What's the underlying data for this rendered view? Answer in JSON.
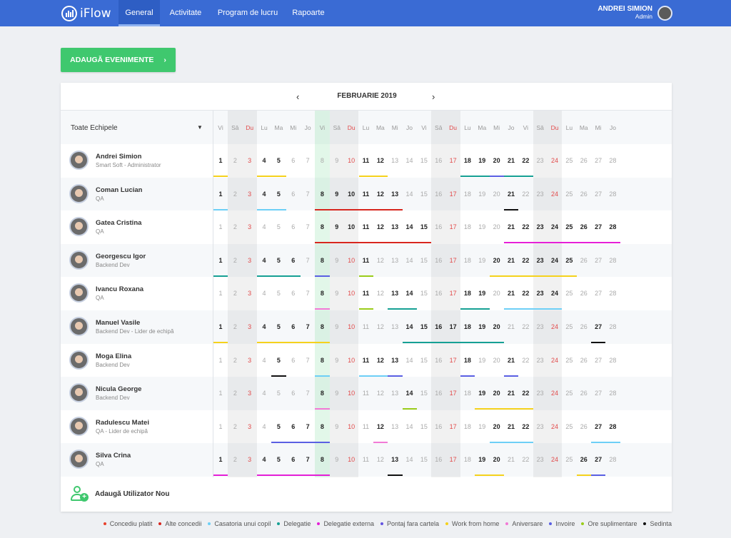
{
  "app": {
    "name": "iFlow"
  },
  "nav": [
    {
      "label": "General",
      "active": true
    },
    {
      "label": "Activitate",
      "active": false
    },
    {
      "label": "Program de lucru",
      "active": false
    },
    {
      "label": "Rapoarte",
      "active": false
    }
  ],
  "user": {
    "name": "ANDREI SIMION",
    "role": "Admin"
  },
  "add_event_button": "ADAUGĂ EVENIMENTE",
  "calendar": {
    "month": "FEBRUARIE 2019",
    "prev_icon": "chevron-left-icon",
    "next_icon": "chevron-right-icon"
  },
  "team_filter": "Toate Echipele",
  "weekday_labels": [
    "Vi",
    "Sâ",
    "Du",
    "Lu",
    "Ma",
    "Mi",
    "Jo",
    "Vi",
    "Sâ",
    "Du",
    "Lu",
    "Ma",
    "Mi",
    "Jo",
    "Vi",
    "Sâ",
    "Du",
    "Lu",
    "Ma",
    "Mi",
    "Jo",
    "Vi",
    "Sâ",
    "Du",
    "Lu",
    "Ma",
    "Mi",
    "Jo"
  ],
  "sunday_days": [
    3,
    10,
    17,
    24
  ],
  "weekend_days": [
    2,
    3,
    9,
    10,
    16,
    17,
    23,
    24
  ],
  "today_day": 8,
  "colors": {
    "concediu_platit": "#e8412c",
    "alte_concedii": "#d7261e",
    "casatoria": "#6dcff6",
    "delegatie": "#16a094",
    "delegatie_externa": "#e51fd7",
    "pontaj": "#6454e0",
    "wfh": "#f5d21c",
    "aniversare": "#f27ad6",
    "invoire": "#5a5fe3",
    "ore_suplimentare": "#9acc1a",
    "sedinta": "#111111"
  },
  "users": [
    {
      "name": "Andrei Simion",
      "role": "Smart Soft - Administrator",
      "bold_days": [
        1,
        4,
        5,
        11,
        12,
        18,
        19,
        20,
        21,
        22
      ],
      "bars": [
        {
          "from": 1,
          "to": 1,
          "color": "wfh"
        },
        {
          "from": 4,
          "to": 5,
          "color": "wfh"
        },
        {
          "from": 11,
          "to": 12,
          "color": "wfh"
        },
        {
          "from": 18,
          "to": 22,
          "color": "delegatie"
        },
        {
          "from": 20,
          "to": 20,
          "color": "invoire"
        }
      ]
    },
    {
      "name": "Coman Lucian",
      "role": "QA",
      "bold_days": [
        1,
        4,
        5,
        8,
        9,
        10,
        11,
        12,
        13,
        21
      ],
      "bars": [
        {
          "from": 1,
          "to": 1,
          "color": "casatoria"
        },
        {
          "from": 4,
          "to": 5,
          "color": "casatoria"
        },
        {
          "from": 8,
          "to": 13,
          "color": "alte_concedii"
        },
        {
          "from": 21,
          "to": 21,
          "color": "sedinta"
        }
      ]
    },
    {
      "name": "Gatea Cristina",
      "role": "QA",
      "bold_days": [
        8,
        9,
        10,
        11,
        12,
        13,
        14,
        15,
        21,
        22,
        23,
        24,
        25,
        26,
        27,
        28
      ],
      "bars": [
        {
          "from": 8,
          "to": 15,
          "color": "alte_concedii"
        },
        {
          "from": 21,
          "to": 28,
          "color": "delegatie_externa"
        }
      ]
    },
    {
      "name": "Georgescu Igor",
      "role": "Backend Dev",
      "bold_days": [
        1,
        4,
        5,
        6,
        8,
        11,
        20,
        21,
        22,
        23,
        24,
        25
      ],
      "bars": [
        {
          "from": 1,
          "to": 1,
          "color": "delegatie"
        },
        {
          "from": 4,
          "to": 6,
          "color": "delegatie"
        },
        {
          "from": 8,
          "to": 8,
          "color": "invoire"
        },
        {
          "from": 11,
          "to": 11,
          "color": "ore_suplimentare"
        },
        {
          "from": 20,
          "to": 25,
          "color": "wfh"
        }
      ]
    },
    {
      "name": "Ivancu Roxana",
      "role": "QA",
      "bold_days": [
        8,
        11,
        13,
        14,
        18,
        19,
        21,
        22,
        23,
        24
      ],
      "bars": [
        {
          "from": 8,
          "to": 8,
          "color": "aniversare"
        },
        {
          "from": 11,
          "to": 11,
          "color": "ore_suplimentare"
        },
        {
          "from": 13,
          "to": 14,
          "color": "delegatie"
        },
        {
          "from": 18,
          "to": 19,
          "color": "delegatie"
        },
        {
          "from": 21,
          "to": 24,
          "color": "casatoria"
        }
      ]
    },
    {
      "name": "Manuel Vasile",
      "role": "Backend Dev - Lider de echipă",
      "bold_days": [
        1,
        4,
        5,
        6,
        7,
        8,
        14,
        15,
        16,
        17,
        18,
        19,
        20,
        27
      ],
      "bars": [
        {
          "from": 1,
          "to": 1,
          "color": "wfh"
        },
        {
          "from": 4,
          "to": 8,
          "color": "wfh"
        },
        {
          "from": 14,
          "to": 20,
          "color": "delegatie"
        },
        {
          "from": 27,
          "to": 27,
          "color": "sedinta"
        }
      ]
    },
    {
      "name": "Moga Elina",
      "role": "Backend Dev",
      "bold_days": [
        5,
        8,
        11,
        12,
        13,
        18,
        21
      ],
      "bars": [
        {
          "from": 5,
          "to": 5,
          "color": "sedinta"
        },
        {
          "from": 8,
          "to": 8,
          "color": "casatoria"
        },
        {
          "from": 11,
          "to": 12,
          "color": "casatoria"
        },
        {
          "from": 13,
          "to": 13,
          "color": "invoire"
        },
        {
          "from": 18,
          "to": 18,
          "color": "invoire"
        },
        {
          "from": 21,
          "to": 21,
          "color": "invoire"
        }
      ]
    },
    {
      "name": "Nicula George",
      "role": "Backend Dev",
      "bold_days": [
        8,
        14,
        19,
        20,
        21,
        22
      ],
      "bars": [
        {
          "from": 8,
          "to": 8,
          "color": "aniversare"
        },
        {
          "from": 14,
          "to": 14,
          "color": "ore_suplimentare"
        },
        {
          "from": 19,
          "to": 22,
          "color": "wfh"
        }
      ]
    },
    {
      "name": "Radulescu Matei",
      "role": "QA - Lider de echipă",
      "bold_days": [
        5,
        6,
        7,
        8,
        12,
        20,
        21,
        22,
        27,
        28
      ],
      "bars": [
        {
          "from": 5,
          "to": 8,
          "color": "invoire"
        },
        {
          "from": 12,
          "to": 12,
          "color": "aniversare"
        },
        {
          "from": 20,
          "to": 22,
          "color": "casatoria"
        },
        {
          "from": 27,
          "to": 28,
          "color": "casatoria"
        }
      ]
    },
    {
      "name": "Silva Crina",
      "role": "QA",
      "bold_days": [
        1,
        4,
        5,
        6,
        7,
        8,
        13,
        19,
        20,
        26,
        27
      ],
      "bars": [
        {
          "from": 1,
          "to": 1,
          "color": "delegatie_externa"
        },
        {
          "from": 4,
          "to": 8,
          "color": "delegatie_externa"
        },
        {
          "from": 13,
          "to": 13,
          "color": "sedinta"
        },
        {
          "from": 19,
          "to": 20,
          "color": "wfh"
        },
        {
          "from": 26,
          "to": 26,
          "color": "wfh"
        },
        {
          "from": 27,
          "to": 27,
          "color": "invoire"
        }
      ]
    }
  ],
  "add_user_label": "Adaugă Utilizator Nou",
  "legend": [
    {
      "label": "Concediu platit",
      "color": "concediu_platit"
    },
    {
      "label": "Alte concedii",
      "color": "alte_concedii"
    },
    {
      "label": "Casatoria unui copil",
      "color": "casatoria"
    },
    {
      "label": "Delegatie",
      "color": "delegatie"
    },
    {
      "label": "Delegatie externa",
      "color": "delegatie_externa"
    },
    {
      "label": "Pontaj fara cartela",
      "color": "pontaj"
    },
    {
      "label": "Work from home",
      "color": "wfh"
    },
    {
      "label": "Aniversare",
      "color": "aniversare"
    },
    {
      "label": "Invoire",
      "color": "invoire"
    },
    {
      "label": "Ore suplimentare",
      "color": "ore_suplimentare"
    },
    {
      "label": "Sedinta",
      "color": "sedinta"
    }
  ]
}
